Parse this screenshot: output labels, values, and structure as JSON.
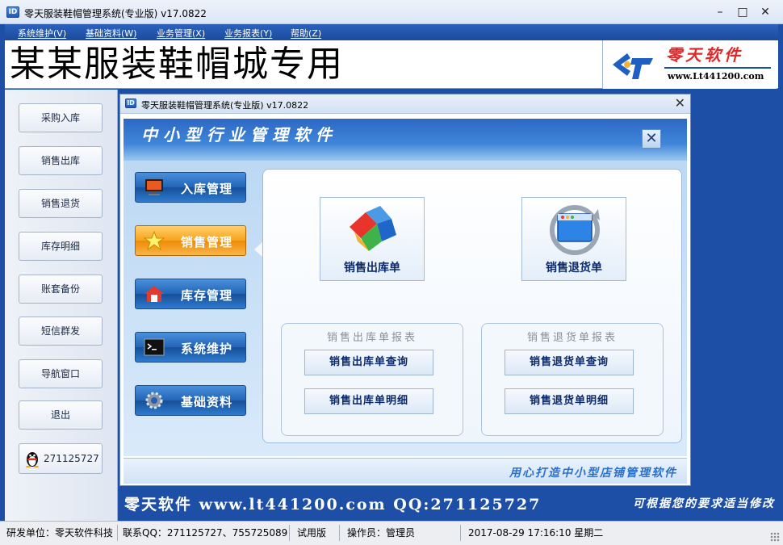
{
  "window": {
    "title": "零天服装鞋帽管理系统(专业版)  v17.0822",
    "icon_text": "ID",
    "minimize": "–",
    "maximize": "□",
    "close": "✕"
  },
  "menu": [
    {
      "label": "系统维护(V)"
    },
    {
      "label": "基础资料(W)"
    },
    {
      "label": "业务管理(X)"
    },
    {
      "label": "业务报表(Y)"
    },
    {
      "label": "帮助(Z)"
    }
  ],
  "banner": {
    "title": "某某服装鞋帽城专用",
    "logo_cn": "零天软件",
    "logo_url": "www.Lt441200.com"
  },
  "sidebar": {
    "buttons": [
      {
        "label": "采购入库"
      },
      {
        "label": "销售出库"
      },
      {
        "label": "销售退货"
      },
      {
        "label": "库存明细"
      },
      {
        "label": "账套备份"
      },
      {
        "label": "短信群发"
      },
      {
        "label": "导航窗口"
      },
      {
        "label": "退出"
      }
    ],
    "qq": "271125727"
  },
  "child_window": {
    "title": "零天服装鞋帽管理系统(专业版) v17.0822",
    "close": "✕",
    "header_text": "中小型行业管理软件",
    "header_close": "✕",
    "nav": [
      {
        "label": "入库管理",
        "icon": "monitor-icon"
      },
      {
        "label": "销售管理",
        "icon": "star-icon"
      },
      {
        "label": "库存管理",
        "icon": "house-icon"
      },
      {
        "label": "系统维护",
        "icon": "terminal-icon"
      },
      {
        "label": "基础资料",
        "icon": "gear-icon"
      }
    ],
    "active_nav": "销售管理",
    "big_buttons": [
      {
        "label": "销售出库单",
        "icon": "puzzle-blocks-icon"
      },
      {
        "label": "销售退货单",
        "icon": "refresh-window-icon"
      }
    ],
    "groups": [
      {
        "title": "销售出库单报表",
        "buttons": [
          "销售出库单查询",
          "销售出库单明细"
        ]
      },
      {
        "title": "销售退货单报表",
        "buttons": [
          "销售退货单查询",
          "销售退货单明细"
        ]
      }
    ],
    "footer_text": "用心打造中小型店铺管理软件"
  },
  "info_strip": {
    "text": "零天软件  www.lt441200.com  QQ:271125727",
    "note": "可根据您的要求适当修改"
  },
  "statusbar": {
    "developer": "研发单位：零天软件科技",
    "contact": "联系QQ：271125727、755725089",
    "edition": "试用版",
    "operator": "操作员：管理员",
    "datetime": "2017-08-29 17:16:10 星期二"
  },
  "colors": {
    "accent_blue": "#1c4fa5",
    "active_orange": "#f7a21c",
    "logo_red": "#e0282a"
  }
}
